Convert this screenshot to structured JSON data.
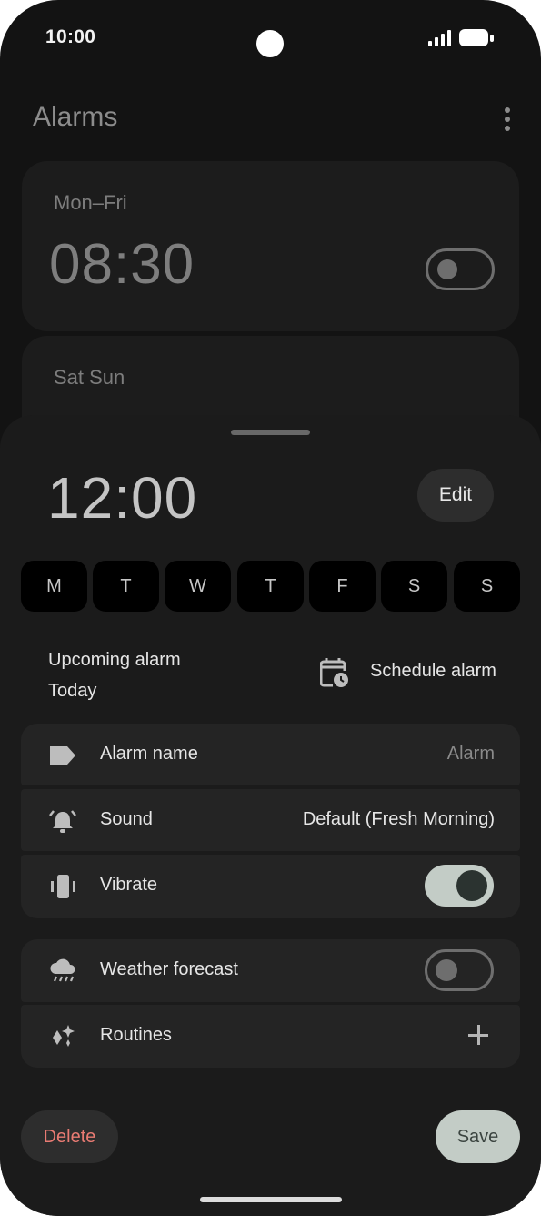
{
  "status_bar": {
    "time": "10:00"
  },
  "header": {
    "title": "Alarms"
  },
  "alarms": [
    {
      "days": "Mon–Fri",
      "time": "08:30",
      "enabled": false
    },
    {
      "days": "Sat Sun"
    }
  ],
  "editor": {
    "time": "12:00",
    "edit_label": "Edit",
    "days": [
      "M",
      "T",
      "W",
      "T",
      "F",
      "S",
      "S"
    ],
    "upcoming_label": "Upcoming alarm",
    "upcoming_value": "Today",
    "schedule_label": "Schedule alarm",
    "settings": {
      "alarm_name_label": "Alarm name",
      "alarm_name_value": "Alarm",
      "sound_label": "Sound",
      "sound_value": "Default (Fresh Morning)",
      "vibrate_label": "Vibrate",
      "vibrate_on": true
    },
    "extras": {
      "weather_label": "Weather forecast",
      "weather_on": false,
      "routines_label": "Routines"
    },
    "delete_label": "Delete",
    "save_label": "Save"
  },
  "colors": {
    "background": "#131313",
    "sheet": "#1b1b1b",
    "row": "#242424",
    "accent_toggle": "#c3ccc6",
    "delete_text": "#e97b73"
  },
  "icons": [
    "signal-icon",
    "battery-icon",
    "more-vert-icon",
    "calendar-clock-icon",
    "label-icon",
    "alarm-bell-icon",
    "vibrate-icon",
    "weather-icon",
    "sparkle-icon",
    "plus-icon"
  ]
}
